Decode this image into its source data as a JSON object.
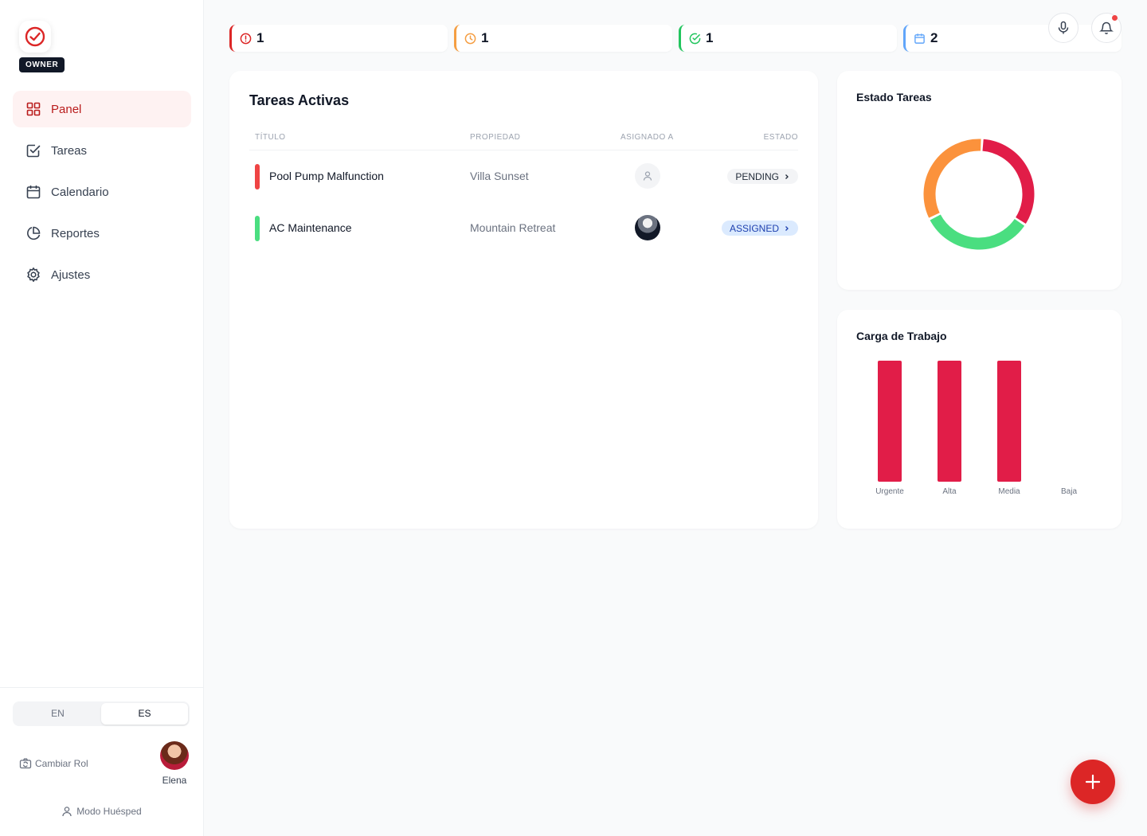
{
  "sidebar": {
    "role_badge": "OWNER",
    "nav": [
      {
        "label": "Panel",
        "icon": "grid-icon",
        "active": true
      },
      {
        "label": "Tareas",
        "icon": "checkbox-icon"
      },
      {
        "label": "Calendario",
        "icon": "calendar-icon"
      },
      {
        "label": "Reportes",
        "icon": "pie-chart-icon"
      },
      {
        "label": "Ajustes",
        "icon": "gear-icon"
      }
    ],
    "languages": [
      "EN",
      "ES"
    ],
    "active_language": "ES",
    "switch_role": "Cambiar Rol",
    "user_name": "Elena",
    "guest_mode": "Modo Huésped"
  },
  "stats": [
    {
      "value": "1",
      "icon": "alert-icon",
      "color": "#dc2626"
    },
    {
      "value": "1",
      "icon": "clock-icon",
      "color": "#f59e42"
    },
    {
      "value": "1",
      "icon": "check-circle-icon",
      "color": "#22c55e"
    },
    {
      "value": "2",
      "icon": "calendar-icon",
      "color": "#60a5fa"
    }
  ],
  "tasks": {
    "title": "Tareas Activas",
    "columns": [
      "TÍTULO",
      "PROPIEDAD",
      "ASIGNADO A",
      "ESTADO"
    ],
    "rows": [
      {
        "title": "Pool Pump Malfunction",
        "property": "Villa Sunset",
        "status": "PENDING",
        "priority_color": "#ef4444"
      },
      {
        "title": "AC Maintenance",
        "property": "Mountain Retreat",
        "status": "ASSIGNED",
        "priority_color": "#4ade80"
      }
    ]
  },
  "donut": {
    "title": "Estado Tareas"
  },
  "workload": {
    "title": "Carga de Trabajo"
  },
  "chart_data": [
    {
      "type": "pie",
      "title": "Estado Tareas",
      "slices": [
        {
          "value": 1,
          "color": "#e11d48"
        },
        {
          "value": 1,
          "color": "#4ade80"
        },
        {
          "value": 1,
          "color": "#fb923c"
        }
      ]
    },
    {
      "type": "bar",
      "title": "Carga de Trabajo",
      "categories": [
        "Urgente",
        "Alta",
        "Media",
        "Baja"
      ],
      "values": [
        1,
        1,
        1,
        0
      ],
      "ylim": [
        0,
        1
      ],
      "color": "#e11d48"
    }
  ]
}
